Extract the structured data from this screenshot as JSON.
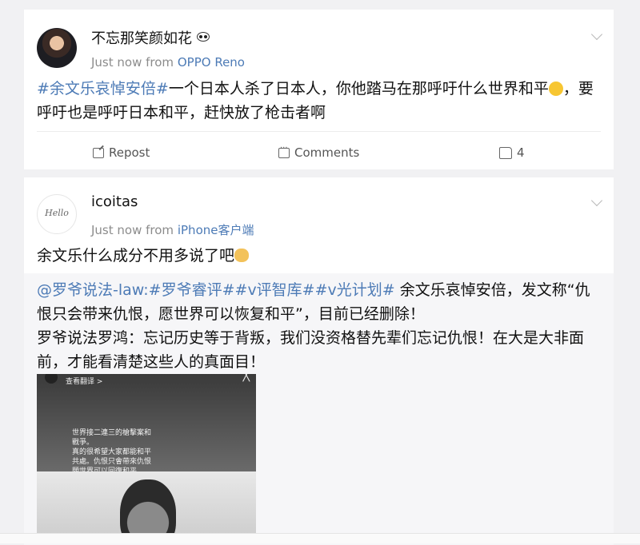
{
  "post1": {
    "user": "不忘那笑颜如花",
    "time": "Just now",
    "from_label": "from",
    "source": "OPPO Reno",
    "hashtag": "#余文乐哀悼安倍#",
    "text_a": "一个日本人杀了日本人，你他踏马在那呼吁什么世界和平",
    "text_b": "，要呼吁也是呼吁日本和平，赶快放了枪击者啊",
    "actions": {
      "repost": "Repost",
      "comments": "Comments",
      "likes": "4"
    }
  },
  "post2": {
    "user": "icoitas",
    "avatar_text": "Hello",
    "time": "Just now",
    "from_label": "from",
    "source": "iPhone客户端",
    "text": "余文乐什么成分不用多说了吧",
    "repost": {
      "tags": "@罗爷说法-law:#罗爷睿评##v评智库##v光计划#",
      "text": " 余文乐哀悼安倍，发文称“仇恨只会带来仇恨，愿世界可以恢复和平”，目前已经删除！",
      "comment": "罗爷说法罗鸿：忘记历史等于背叛，我们没资格替先辈们忘记仇恨！在大是大非面前，才能看清楚这些人的真面目！",
      "image": {
        "header": "查看翻译 >",
        "lines": [
          "世界接二連三的槍擊案和",
          "戰爭。",
          "真的很希望大家都能和平",
          "共處。仇恨只會帶來仇恨",
          "願世界可以回復和平"
        ],
        "close": "╳"
      }
    }
  }
}
